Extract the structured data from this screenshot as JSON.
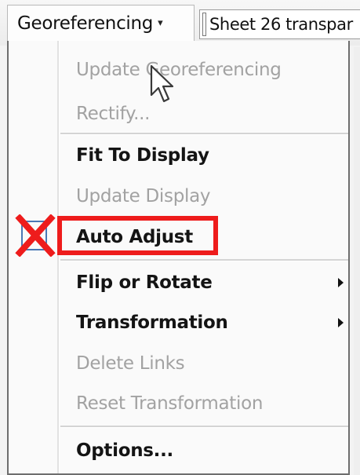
{
  "toolbar": {
    "georeferencing_label": "Georeferencing",
    "georeferencing_caret": "▾",
    "layer_combo_value": "Sheet 26 transpar"
  },
  "menu": {
    "items": [
      {
        "label": "Update Georeferencing",
        "enabled": false
      },
      {
        "label": "Rectify...",
        "enabled": false
      },
      {
        "label": "Fit To Display",
        "enabled": true
      },
      {
        "label": "Update Display",
        "enabled": false
      },
      {
        "label": "Auto Adjust",
        "enabled": true,
        "checked": false,
        "highlighted": true
      },
      {
        "label": "Flip or Rotate",
        "enabled": true,
        "submenu": true
      },
      {
        "label": "Transformation",
        "enabled": true,
        "submenu": true
      },
      {
        "label": "Delete Links",
        "enabled": false
      },
      {
        "label": "Reset Transformation",
        "enabled": false
      },
      {
        "label": "Options...",
        "enabled": true
      }
    ]
  },
  "annotations": {
    "highlight_color": "#ee1c1c",
    "x_mark_icon": "red-x-icon"
  },
  "colors": {
    "menu_background": "#fafafa",
    "disabled_text": "#a2a2a2",
    "enabled_text": "#141414",
    "checkbox_border": "#4a78b5"
  }
}
